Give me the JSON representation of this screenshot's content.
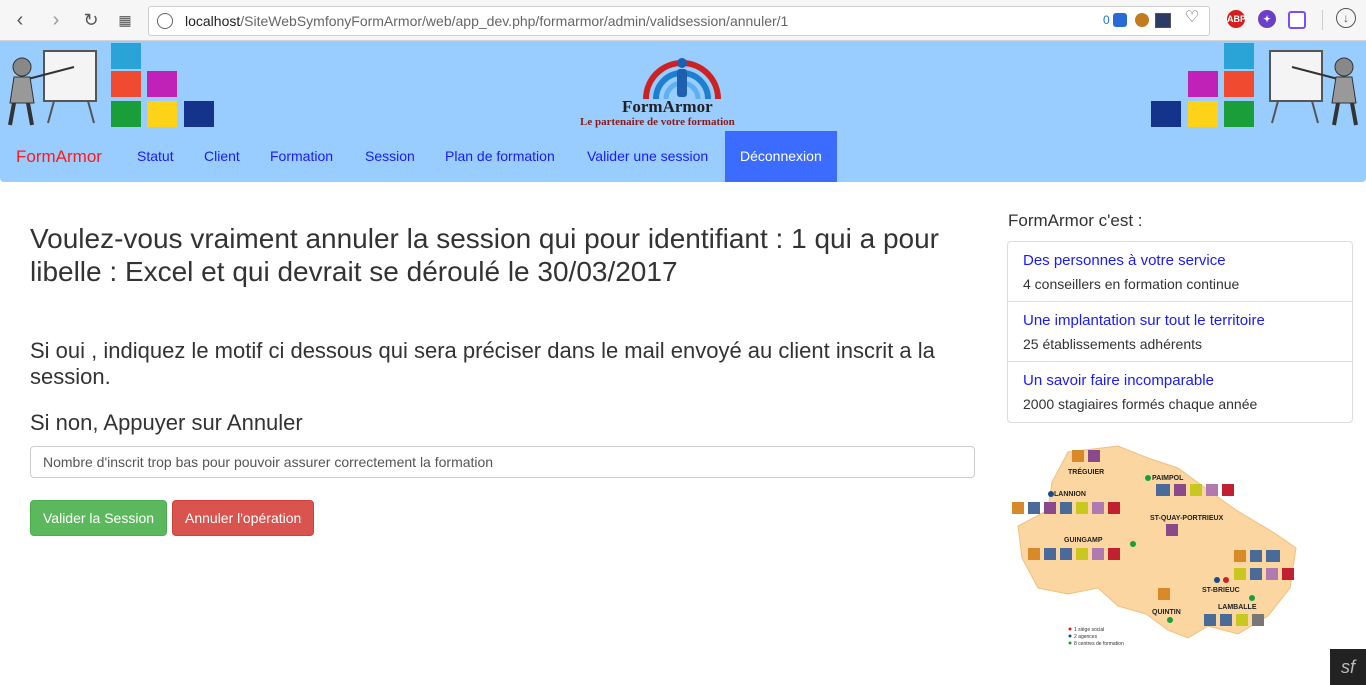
{
  "browser": {
    "url_host": "localhost",
    "url_path": "/SiteWebSymfonyFormArmor/web/app_dev.php/formarmor/admin/validsession/annuler/1",
    "badge_count": "0",
    "ext_abp": "ABP"
  },
  "header": {
    "logo_title": "FormArmor",
    "logo_subtitle": "Le partenaire de votre formation"
  },
  "nav": {
    "brand": "FormArmor",
    "items": [
      "Statut",
      "Client",
      "Formation",
      "Session",
      "Plan de formation",
      "Valider une session"
    ],
    "active": "Déconnexion"
  },
  "main": {
    "question": "Voulez-vous vraiment annuler la session qui pour identifiant : 1 qui a pour libelle : Excel et qui devrait se déroulé le 30/03/2017",
    "if_yes": "Si oui , indiquez le motif ci dessous qui sera préciser dans le mail envoyé au client inscrit a la session.",
    "if_no": "Si non, Appuyer sur Annuler",
    "reason_value": "Nombre d'inscrit trop bas pour pouvoir assurer correctement la formation",
    "btn_validate": "Valider la Session",
    "btn_cancel": "Annuler l'opération"
  },
  "sidebar": {
    "title": "FormArmor c'est :",
    "items": [
      {
        "title": "Des personnes à votre service",
        "text": "4 conseillers en formation continue"
      },
      {
        "title": "Une implantation sur tout le territoire",
        "text": "25 établissements adhérents"
      },
      {
        "title": "Un savoir faire incomparable",
        "text": "2000 stagiaires formés chaque année"
      }
    ]
  },
  "map": {
    "cities": [
      "TRÉGUIER",
      "PAIMPOL",
      "LANNION",
      "ST-QUAY-PORTRIEUX",
      "GUINGAMP",
      "ST-BRIEUC",
      "QUINTIN",
      "LAMBALLE"
    ],
    "legend": [
      "1 siège social",
      "2 agences",
      "8 centres de formation"
    ]
  },
  "colors": {
    "banner": "#99ccff",
    "brand": "#ff1a1a",
    "link": "#1a1aff",
    "active_nav": "#3b6cff",
    "success": "#5cb85c",
    "danger": "#d9534f"
  }
}
